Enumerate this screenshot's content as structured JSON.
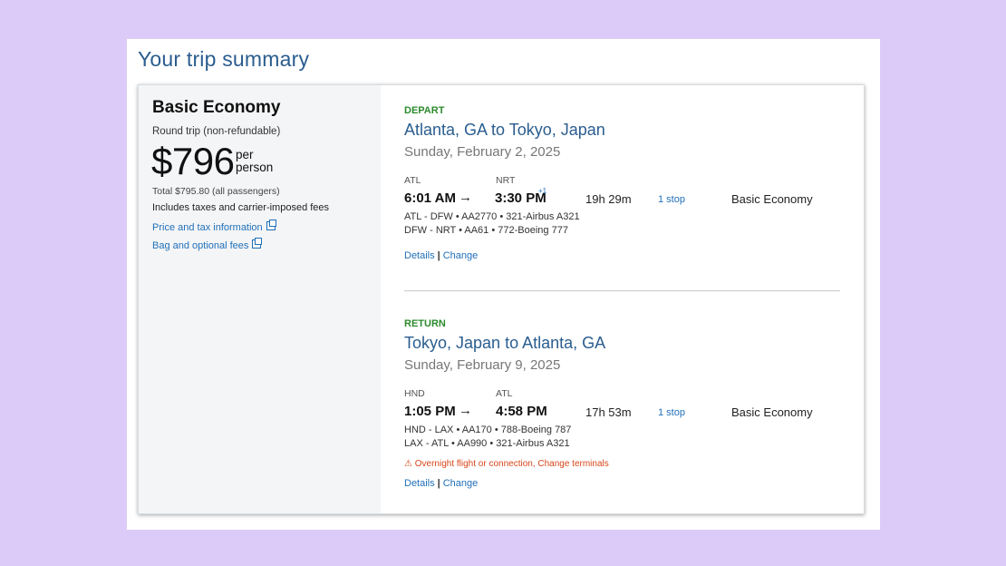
{
  "page": {
    "title": "Your trip summary"
  },
  "fare": {
    "name": "Basic Economy",
    "trip_type": "Round trip (non-refundable)",
    "price": "$796",
    "per_line1": "per",
    "per_line2": "person",
    "total": "Total $795.80 (all passengers)",
    "includes": "Includes taxes and carrier-imposed fees",
    "links": [
      {
        "label": "Price and tax information",
        "icon": "external-link-icon"
      },
      {
        "label": "Bag and optional fees",
        "icon": "external-link-icon"
      }
    ]
  },
  "segments": [
    {
      "label": "DEPART",
      "route": "Atlanta, GA to Tokyo, Japan",
      "date": "Sunday, February 2, 2025",
      "origin_code": "ATL",
      "dest_code": "NRT",
      "depart_time": "6:01 AM",
      "arrow": "→",
      "arrive_time": "3:30 PM",
      "day_offset": "+1",
      "duration": "19h 29m",
      "stops": "1 stop",
      "cabin": "Basic Economy",
      "legs": [
        "ATL - DFW • AA2770 • 321-Airbus A321",
        "DFW - NRT • AA61 • 772-Boeing 777"
      ],
      "warning": "",
      "details": "Details",
      "change": "Change"
    },
    {
      "label": "RETURN",
      "route": "Tokyo, Japan to Atlanta, GA",
      "date": "Sunday, February 9, 2025",
      "origin_code": "HND",
      "dest_code": "ATL",
      "depart_time": "1:05 PM",
      "arrow": "→",
      "arrive_time": "4:58 PM",
      "day_offset": "",
      "duration": "17h 53m",
      "stops": "1 stop",
      "cabin": "Basic Economy",
      "legs": [
        "HND - LAX • AA170 • 788-Boeing 787",
        "LAX - ATL • AA990 • 321-Airbus A321"
      ],
      "warning": "⚠ Overnight flight or connection, Change terminals",
      "details": "Details",
      "change": "Change"
    }
  ],
  "colors": {
    "background": "#dccbf8",
    "title_blue": "#2a5d8f",
    "link_blue": "#1f6fb8",
    "label_green": "#2b8a2b",
    "warning_orange": "#d8461a"
  }
}
